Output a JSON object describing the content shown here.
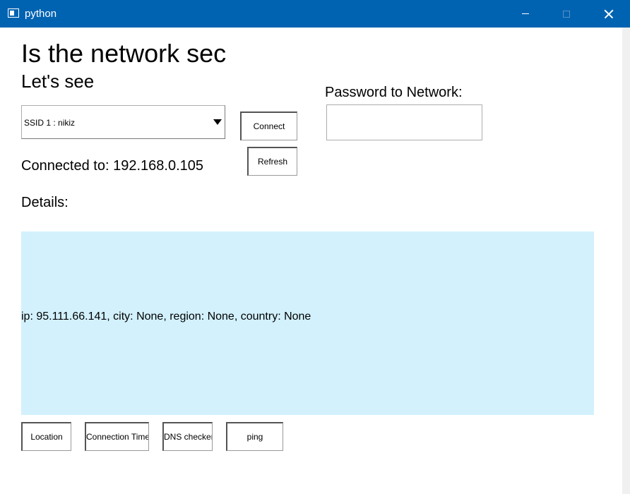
{
  "window": {
    "title": "python",
    "icons": {
      "app": "window-app-icon",
      "minimize": "minimize-icon",
      "maximize": "maximize-icon",
      "close": "close-icon"
    },
    "colors": {
      "titlebar": "#0063b1",
      "details_panel": "#d2f1fd"
    }
  },
  "header": {
    "title": "Is the network sec",
    "subtitle": "Let's see"
  },
  "password": {
    "label": "Password to Network:",
    "value": "",
    "placeholder": ""
  },
  "network_select": {
    "selected": "SSID 1 : nikiz"
  },
  "buttons": {
    "connect": "Connect",
    "refresh": "Refresh",
    "location": "Location",
    "connection_time": "Connection Time",
    "dns_checker": "DNS checker",
    "ping": "ping"
  },
  "status": {
    "connected_to": "Connected to: 192.168.0.105"
  },
  "details": {
    "label": "Details:",
    "text": "ip: 95.111.66.141, city: None, region: None, country: None"
  }
}
